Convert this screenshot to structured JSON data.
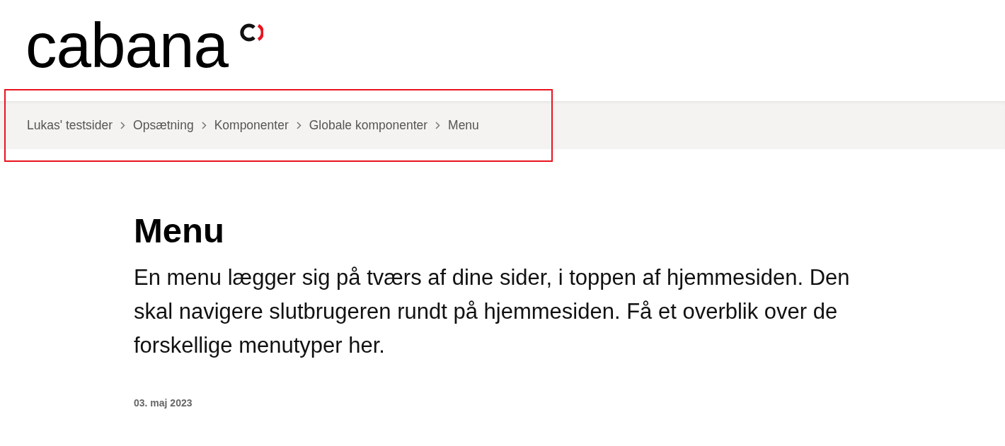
{
  "header": {
    "logo_text": "cabana"
  },
  "breadcrumb": {
    "highlighted": true,
    "items": [
      {
        "label": "Lukas' testsider"
      },
      {
        "label": "Opsætning"
      },
      {
        "label": "Komponenter"
      },
      {
        "label": "Globale komponenter"
      },
      {
        "label": "Menu"
      }
    ]
  },
  "article": {
    "title": "Menu",
    "intro": "En menu lægger sig på tværs af dine sider, i toppen af hjemmesiden. Den skal navigere slutbrugeren rundt på hjemmesiden. Få et overblik over de forskellige menutyper her.",
    "date": "03. maj 2023"
  }
}
